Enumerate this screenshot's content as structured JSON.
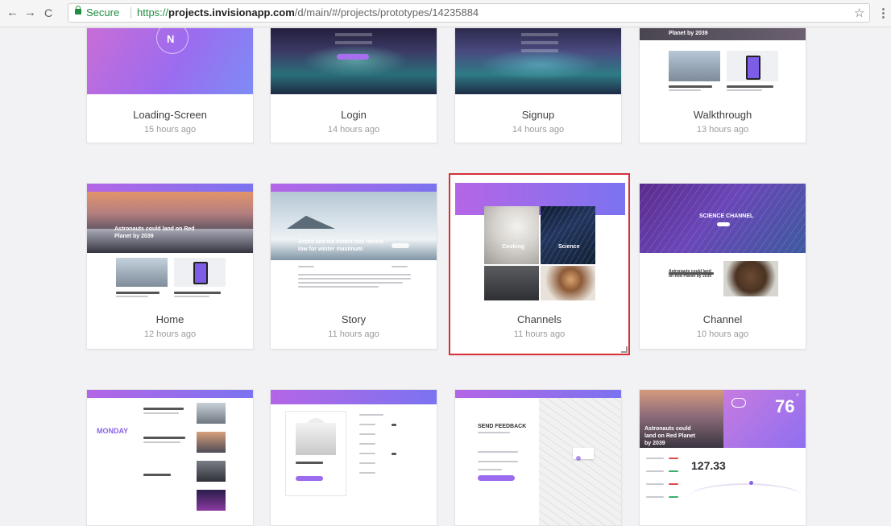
{
  "browser": {
    "back": "←",
    "forward": "→",
    "reload": "C",
    "secure_label": "Secure",
    "url_protocol": "https://",
    "url_host": "projects.invisionapp.com",
    "url_path": "/d/main/#/projects/prototypes/14235884",
    "star": "☆",
    "menu": "⋮"
  },
  "colors": {
    "accent_purple": "#9b6cf0",
    "selected_border": "#d6303a"
  },
  "screens": [
    {
      "name": "Loading-Screen",
      "time": "15 hours ago"
    },
    {
      "name": "Login",
      "time": "14 hours ago"
    },
    {
      "name": "Signup",
      "time": "14 hours ago"
    },
    {
      "name": "Walkthrough",
      "time": "13 hours ago"
    },
    {
      "name": "Home",
      "time": "12 hours ago"
    },
    {
      "name": "Story",
      "time": "11 hours ago"
    },
    {
      "name": "Channels",
      "time": "11 hours ago"
    },
    {
      "name": "Channel",
      "time": "10 hours ago"
    }
  ],
  "thumb_text": {
    "logo_letter": "N",
    "walkthrough_headline": "Planet by 2039",
    "home_headline": "Astronauts could land on Red Planet by 2039",
    "story_headline": "Arctic sea ice extent hits record low for winter maximum",
    "channels_cooking": "Cooking",
    "channels_science": "Science",
    "channel_title": "SCIENCE CHANNEL",
    "channel_caption": "Astronauts could land on Red Planet by 2039",
    "monday": "MONDAY",
    "feedback_title": "SEND FEEDBACK",
    "weather_headline": "Astronauts could land on Red Planet by 2039",
    "weather_temp": "76",
    "weather_deg": "°",
    "weather_value": "127.33"
  }
}
